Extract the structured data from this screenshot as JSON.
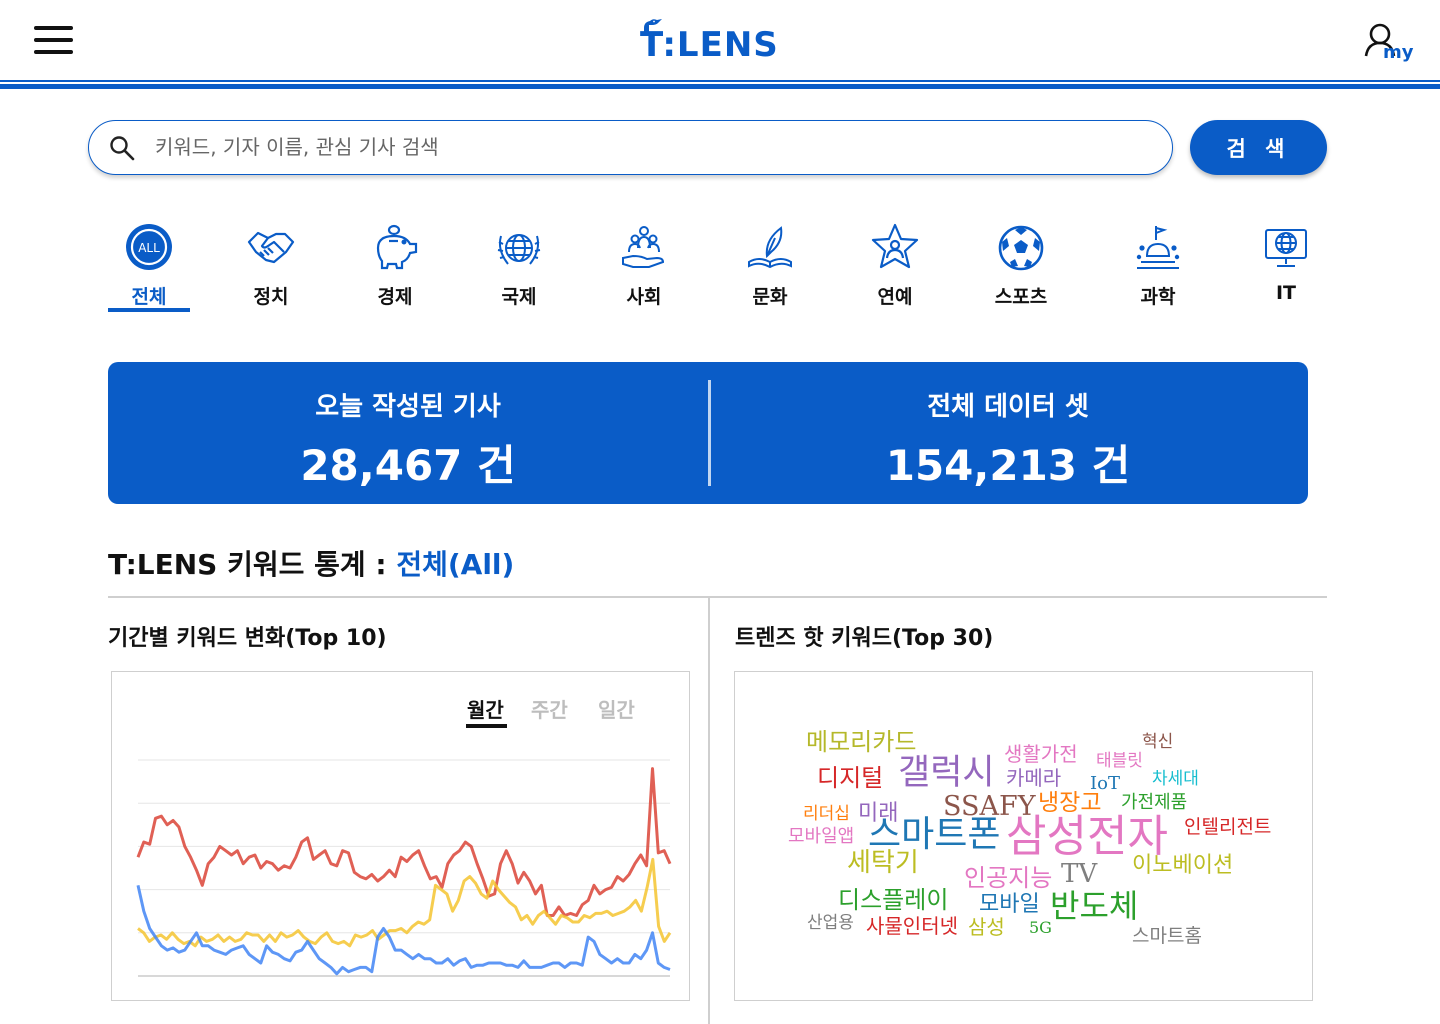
{
  "header": {
    "logo_text": "T:LENS",
    "my_label": "my"
  },
  "search": {
    "placeholder": "키워드, 기자 이름, 관심 기사 검색",
    "value": "",
    "button_label": "검 색"
  },
  "categories": [
    {
      "label": "전체",
      "icon": "all-icon",
      "active": true
    },
    {
      "label": "정치",
      "icon": "handshake-icon",
      "active": false
    },
    {
      "label": "경제",
      "icon": "piggy-bank-icon",
      "active": false
    },
    {
      "label": "국제",
      "icon": "globe-laurel-icon",
      "active": false
    },
    {
      "label": "사회",
      "icon": "people-hand-icon",
      "active": false
    },
    {
      "label": "문화",
      "icon": "quill-book-icon",
      "active": false
    },
    {
      "label": "연예",
      "icon": "star-person-icon",
      "active": false
    },
    {
      "label": "스포츠",
      "icon": "soccer-ball-icon",
      "active": false
    },
    {
      "label": "과학",
      "icon": "flask-icon",
      "active": false
    },
    {
      "label": "IT",
      "icon": "monitor-globe-icon",
      "active": false
    }
  ],
  "stats": {
    "today": {
      "title": "오늘 작성된 기사",
      "value": "28,467 건"
    },
    "total": {
      "title": "전체 데이터 셋",
      "value": "154,213 건"
    }
  },
  "keyword_stats": {
    "title_prefix": "T:LENS 키워드 통계 :",
    "title_accent": "전체(All)"
  },
  "trend_chart": {
    "title": "기간별 키워드 변화(Top 10)",
    "tabs": [
      {
        "label": "월간",
        "active": true
      },
      {
        "label": "주간",
        "active": false
      },
      {
        "label": "일간",
        "active": false
      }
    ]
  },
  "chart_data": {
    "type": "line",
    "title": "",
    "xlabel": "",
    "ylabel": "",
    "ylim": [
      0,
      100
    ],
    "grid": true,
    "series": [
      {
        "color": "#db4437",
        "values": [
          55,
          62,
          61,
          73,
          74,
          70,
          72,
          69,
          60,
          55,
          49,
          42,
          52,
          55,
          60,
          58,
          56,
          58,
          52,
          55,
          56,
          50,
          53,
          52,
          49,
          51,
          50,
          55,
          62,
          64,
          54,
          56,
          58,
          52,
          51,
          58,
          57,
          48,
          46,
          45,
          47,
          44,
          46,
          49,
          46,
          55,
          53,
          56,
          58,
          51,
          45,
          46,
          41,
          52,
          56,
          58,
          62,
          60,
          52,
          45,
          37,
          38,
          52,
          58,
          52,
          43,
          48,
          44,
          38,
          42,
          28,
          28,
          32,
          28,
          29,
          28,
          33,
          35,
          42,
          38,
          40,
          41,
          46,
          44,
          47,
          52,
          56,
          51,
          96,
          57,
          58,
          52
        ]
      },
      {
        "color": "#f4c430",
        "values": [
          22,
          20,
          16,
          18,
          19,
          17,
          20,
          17,
          15,
          16,
          14,
          18,
          16,
          17,
          19,
          16,
          18,
          16,
          17,
          20,
          19,
          19,
          16,
          19,
          16,
          20,
          18,
          19,
          21,
          18,
          16,
          15,
          18,
          20,
          16,
          15,
          16,
          14,
          19,
          18,
          19,
          21,
          17,
          19,
          21,
          21,
          22,
          20,
          23,
          25,
          24,
          26,
          42,
          40,
          38,
          30,
          35,
          44,
          46,
          43,
          38,
          36,
          44,
          40,
          37,
          34,
          32,
          26,
          28,
          24,
          28,
          30,
          27,
          24,
          28,
          27,
          25,
          25,
          28,
          27,
          29,
          29,
          30,
          28,
          29,
          30,
          32,
          35,
          30,
          41,
          54,
          23,
          16,
          20
        ]
      },
      {
        "color": "#4285f4",
        "values": [
          42,
          30,
          22,
          18,
          14,
          12,
          13,
          11,
          12,
          16,
          20,
          14,
          14,
          12,
          11,
          10,
          12,
          13,
          14,
          10,
          8,
          6,
          14,
          11,
          10,
          8,
          7,
          11,
          12,
          16,
          12,
          8,
          6,
          4,
          1,
          4,
          2,
          3,
          4,
          4,
          2,
          18,
          22,
          18,
          12,
          12,
          10,
          8,
          10,
          8,
          8,
          6,
          6,
          8,
          5,
          7,
          8,
          4,
          5,
          5,
          6,
          6,
          6,
          5,
          5,
          4,
          7,
          4,
          4,
          4,
          5,
          6,
          6,
          4,
          6,
          6,
          5,
          18,
          16,
          10,
          8,
          6,
          8,
          6,
          6,
          10,
          8,
          12,
          20,
          6,
          4,
          3
        ]
      }
    ]
  },
  "hot_keywords": {
    "title": "트렌즈 핫 키워드(Top 30)",
    "words": [
      {
        "text": "메모리카드",
        "color": "#b5b82a"
      },
      {
        "text": "생활가전",
        "color": "#e377c2"
      },
      {
        "text": "혁신",
        "color": "#8c564b"
      },
      {
        "text": "디지털",
        "color": "#d62728"
      },
      {
        "text": "갤럭시",
        "color": "#9467bd"
      },
      {
        "text": "카메라",
        "color": "#9467bd"
      },
      {
        "text": "태블릿",
        "color": "#e377c2"
      },
      {
        "text": "IoT",
        "color": "#1f77b4"
      },
      {
        "text": "차세대",
        "color": "#17becf"
      },
      {
        "text": "SSAFY",
        "color": "#8c564b"
      },
      {
        "text": "냉장고",
        "color": "#ff7f0e"
      },
      {
        "text": "가전제품",
        "color": "#2ca02c"
      },
      {
        "text": "리더십",
        "color": "#ff7f0e"
      },
      {
        "text": "미래",
        "color": "#9467bd"
      },
      {
        "text": "인텔리전트",
        "color": "#d62728"
      },
      {
        "text": "모바일앱",
        "color": "#e377c2"
      },
      {
        "text": "스마트폰",
        "color": "#1f77b4"
      },
      {
        "text": "삼성전자",
        "color": "#e377c2"
      },
      {
        "text": "세탁기",
        "color": "#bcbd22"
      },
      {
        "text": "이노베이션",
        "color": "#bcbd22"
      },
      {
        "text": "인공지능",
        "color": "#e377c2"
      },
      {
        "text": "TV",
        "color": "#7f7f7f"
      },
      {
        "text": "디스플레이",
        "color": "#2ca02c"
      },
      {
        "text": "모바일",
        "color": "#1f77b4"
      },
      {
        "text": "반도체",
        "color": "#2ca02c"
      },
      {
        "text": "산업용",
        "color": "#7f7f7f"
      },
      {
        "text": "사물인터넷",
        "color": "#d62728"
      },
      {
        "text": "삼성",
        "color": "#bcbd22"
      },
      {
        "text": "5G",
        "color": "#2ca02c"
      },
      {
        "text": "스마트홈",
        "color": "#7f7f7f"
      }
    ]
  },
  "colors": {
    "brand": "#0a5cc7"
  }
}
